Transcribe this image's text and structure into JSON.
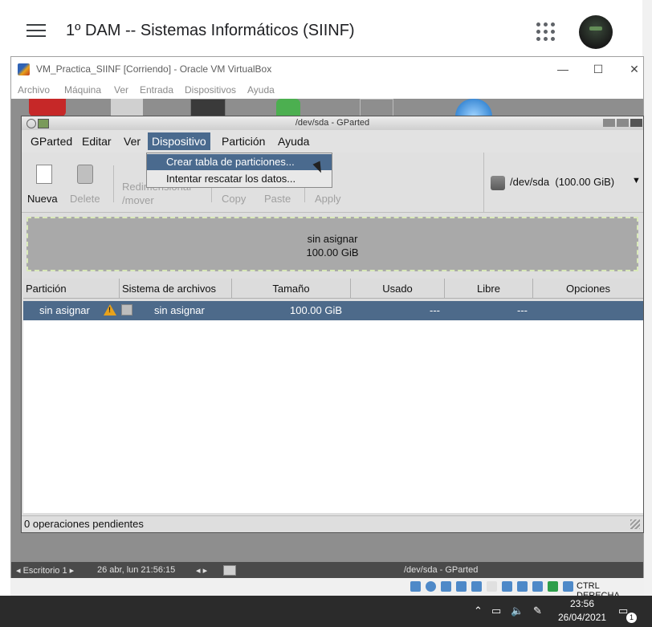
{
  "classroom": {
    "title": "1º DAM -- Sistemas Informáticos (SIINF)",
    "icons": [
      "menu-icon",
      "apps-grid-icon",
      "avatar"
    ]
  },
  "vbox": {
    "window_title": "VM_Practica_SIINF [Corriendo] - Oracle VM VirtualBox",
    "controls": {
      "minimize": "—",
      "maximize": "☐",
      "close": "✕"
    },
    "menu": [
      "Archivo",
      "Máquina",
      "Ver",
      "Entrada",
      "Dispositivos",
      "Ayuda"
    ],
    "host_key": "CTRL DERECHA"
  },
  "guest": {
    "bar_desktop": "◂ Escritorio 1 ▸",
    "bar_datetime": "26 abr, lun 21:56:15",
    "bar_nav": "◂ ▸",
    "bar_window": "/dev/sda - GParted"
  },
  "gparted": {
    "title": "/dev/sda - GParted",
    "menu": [
      "GParted",
      "Editar",
      "Ver",
      "Dispositivo",
      "Partición",
      "Ayuda"
    ],
    "dropdown": [
      "Crear tabla de particiones...",
      "Intentar rescatar los datos..."
    ],
    "toolbar": {
      "new": "Nueva",
      "delete": "Delete",
      "resize": "Redimensionar\n/mover",
      "copy": "Copy",
      "paste": "Paste",
      "apply": "Apply"
    },
    "device": {
      "name": "/dev/sda",
      "size": "(100.00 GiB)"
    },
    "map": {
      "label": "sin asignar",
      "size": "100.00 GiB"
    },
    "columns": [
      "Partición",
      "Sistema de archivos",
      "Tamaño",
      "Usado",
      "Libre",
      "Opciones"
    ],
    "rows": [
      {
        "particion": "sin asignar",
        "sistema": "sin asignar",
        "tamano": "100.00 GiB",
        "usado": "---",
        "libre": "---",
        "opciones": ""
      }
    ],
    "status": "0 operaciones pendientes"
  },
  "taskbar": {
    "time": "23:56",
    "date": "26/04/2021",
    "notification_count": "1"
  }
}
